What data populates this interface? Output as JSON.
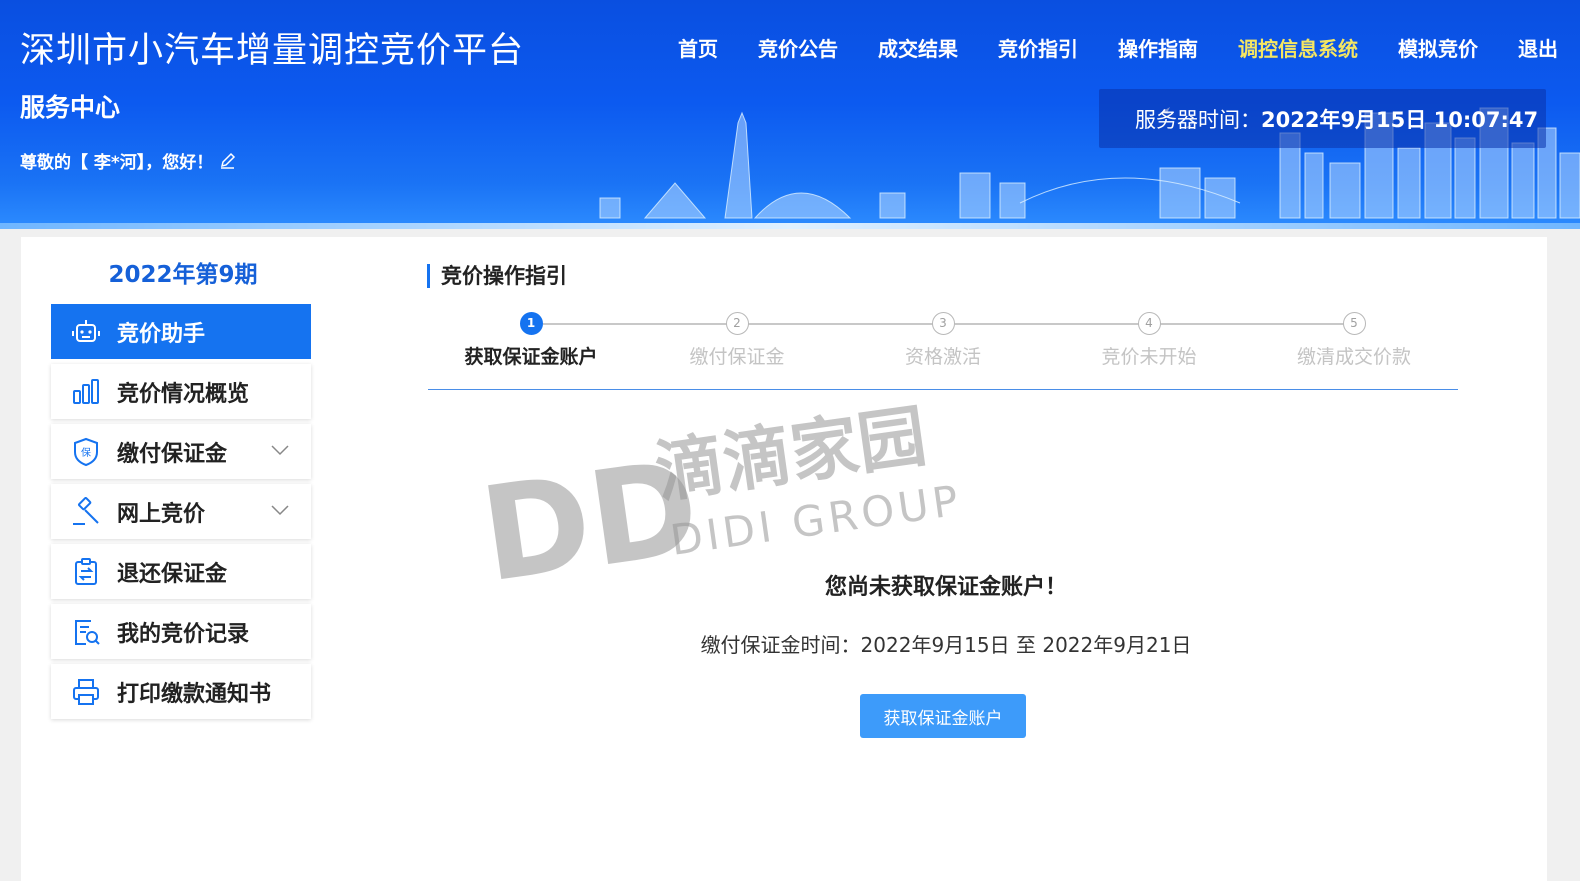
{
  "header": {
    "site_title": "深圳市小汽车增量调控竞价平台",
    "subtitle": "服务中心",
    "greeting": "尊敬的【 李*河】，您好！",
    "nav": [
      {
        "label": "首页",
        "highlight": false
      },
      {
        "label": "竞价公告",
        "highlight": false
      },
      {
        "label": "成交结果",
        "highlight": false
      },
      {
        "label": "竞价指引",
        "highlight": false
      },
      {
        "label": "操作指南",
        "highlight": false
      },
      {
        "label": "调控信息系统",
        "highlight": true
      },
      {
        "label": "模拟竞价",
        "highlight": false
      },
      {
        "label": "退出",
        "highlight": false
      }
    ],
    "server_time_label": "服务器时间：",
    "server_time_value": "2022年9月15日 10:07:47"
  },
  "sidebar": {
    "period": "2022年第9期",
    "menu": [
      {
        "label": "竞价助手",
        "icon": "robot-icon",
        "active": true,
        "expandable": false
      },
      {
        "label": "竞价情况概览",
        "icon": "bar-chart-icon",
        "active": false,
        "expandable": false
      },
      {
        "label": "缴付保证金",
        "icon": "shield-icon",
        "active": false,
        "expandable": true
      },
      {
        "label": "网上竞价",
        "icon": "gavel-icon",
        "active": false,
        "expandable": true
      },
      {
        "label": "退还保证金",
        "icon": "refund-icon",
        "active": false,
        "expandable": false
      },
      {
        "label": "我的竞价记录",
        "icon": "record-search-icon",
        "active": false,
        "expandable": false
      },
      {
        "label": "打印缴款通知书",
        "icon": "printer-icon",
        "active": false,
        "expandable": false
      }
    ]
  },
  "main": {
    "section_title": "竞价操作指引",
    "steps": [
      {
        "num": "1",
        "label": "获取保证金账户",
        "active": true
      },
      {
        "num": "2",
        "label": "缴付保证金",
        "active": false
      },
      {
        "num": "3",
        "label": "资格激活",
        "active": false
      },
      {
        "num": "4",
        "label": "竞价未开始",
        "active": false
      },
      {
        "num": "5",
        "label": "缴清成交价款",
        "active": false
      }
    ],
    "notice": "您尚未获取保证金账户！",
    "period_info": "缴付保证金时间：2022年9月15日 至 2022年9月21日",
    "button_label": "获取保证金账户"
  },
  "watermark": {
    "logo": "DD",
    "cn": "滴滴家园",
    "en": "DIDI GROUP"
  },
  "colors": {
    "accent": "#1573f0",
    "header_blue": "#0c5af0",
    "highlight_nav": "#f5e663",
    "button": "#3d9bfa"
  }
}
